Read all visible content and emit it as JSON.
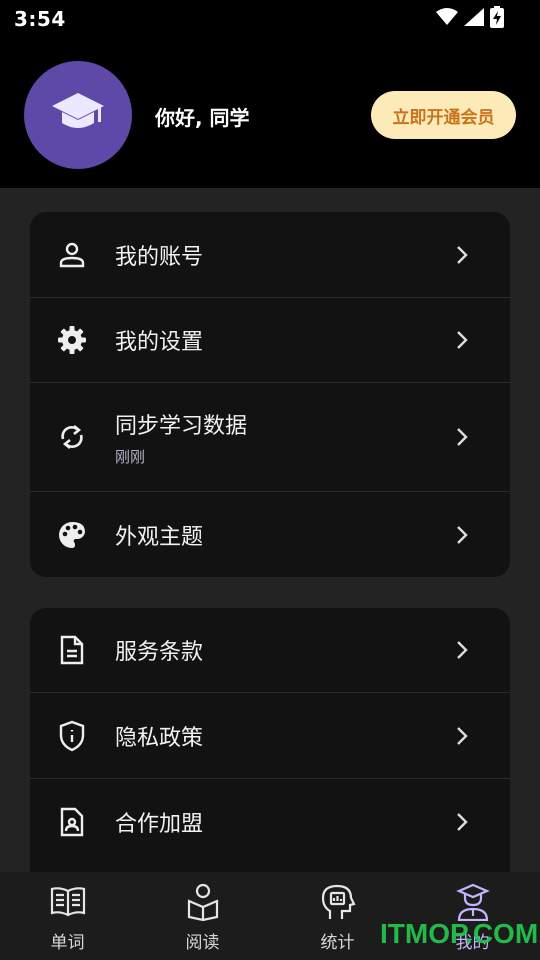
{
  "status_bar": {
    "time": "3:54"
  },
  "header": {
    "greeting": "你好, 同学",
    "vip_label": "立即开通会员"
  },
  "menu_group_1": [
    {
      "label": "我的账号",
      "icon": "person-icon"
    },
    {
      "label": "我的设置",
      "icon": "gear-icon"
    },
    {
      "label": "同步学习数据",
      "sub": "刚刚",
      "icon": "sync-icon"
    },
    {
      "label": "外观主题",
      "icon": "palette-icon"
    }
  ],
  "menu_group_2": [
    {
      "label": "服务条款",
      "icon": "document-icon"
    },
    {
      "label": "隐私政策",
      "icon": "shield-icon"
    },
    {
      "label": "合作加盟",
      "icon": "contact-card-icon"
    }
  ],
  "bottom_nav": [
    {
      "label": "单词",
      "icon": "book-icon"
    },
    {
      "label": "阅读",
      "icon": "reader-icon"
    },
    {
      "label": "统计",
      "icon": "brain-chart-icon"
    },
    {
      "label": "我的",
      "icon": "student-icon",
      "active": true
    }
  ],
  "watermark": "ITMOP.COM",
  "colors": {
    "avatar_bg": "#5e48a8",
    "vip_bg": "#fdeab9",
    "vip_text": "#c9731a",
    "active_tab": "#c4b5ff"
  }
}
